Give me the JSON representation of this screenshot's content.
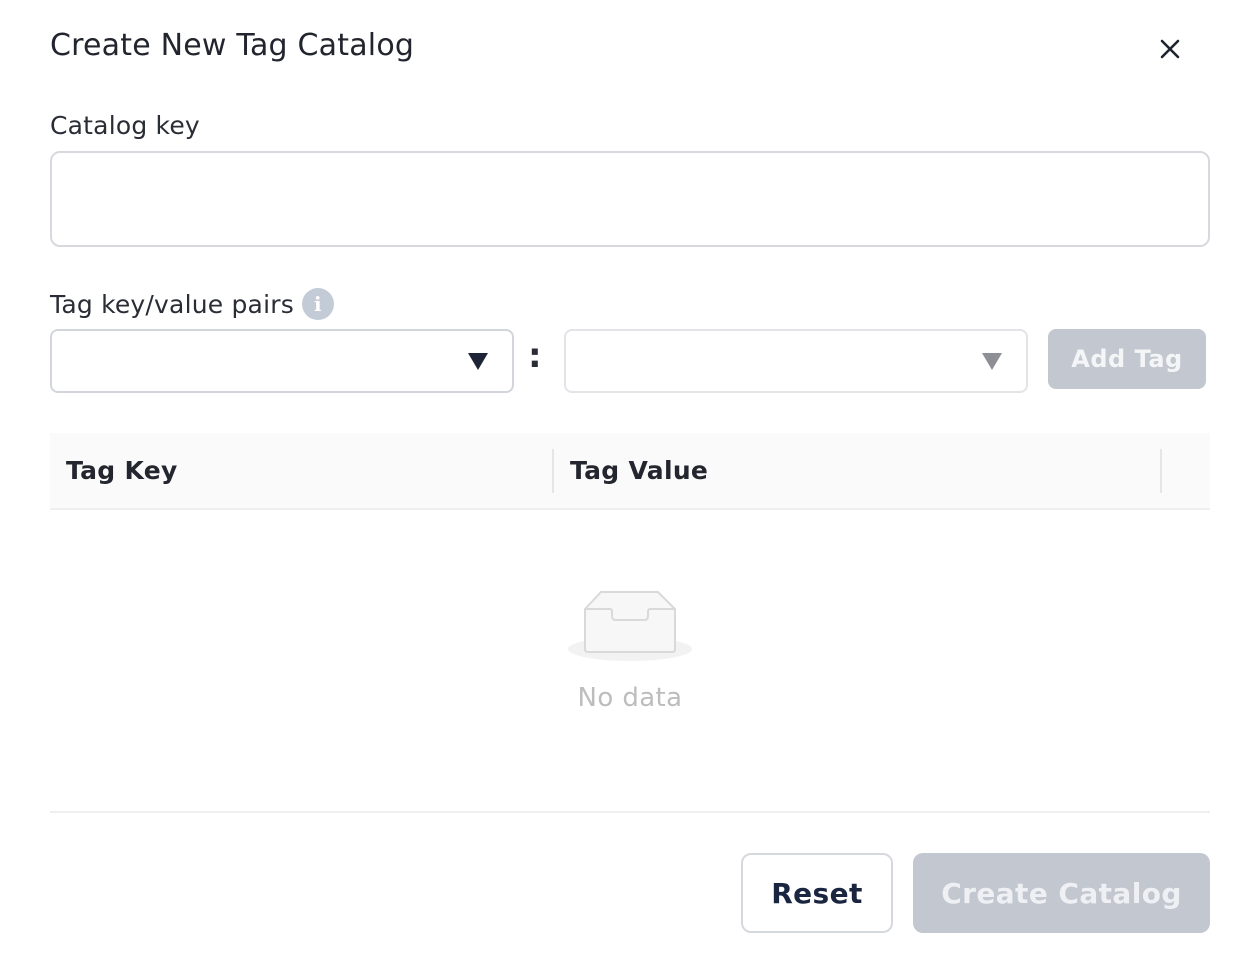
{
  "dialog": {
    "title": "Create New Tag Catalog"
  },
  "catalog_key": {
    "label": "Catalog key",
    "value": "",
    "placeholder": ""
  },
  "tag_pairs": {
    "label": "Tag key/value pairs",
    "info_icon": "info-icon",
    "key_select_value": "",
    "separator": ":",
    "value_select_value": "",
    "add_button_label": "Add Tag"
  },
  "table": {
    "columns": [
      "Tag Key",
      "Tag Value"
    ],
    "rows": [],
    "empty_text": "No data",
    "empty_icon": "empty-inbox-icon"
  },
  "footer": {
    "reset_label": "Reset",
    "create_label": "Create Catalog"
  },
  "colors": {
    "disabled_button": "#c2c7d0",
    "text_primary": "#22252d",
    "border": "#d7d9de"
  }
}
